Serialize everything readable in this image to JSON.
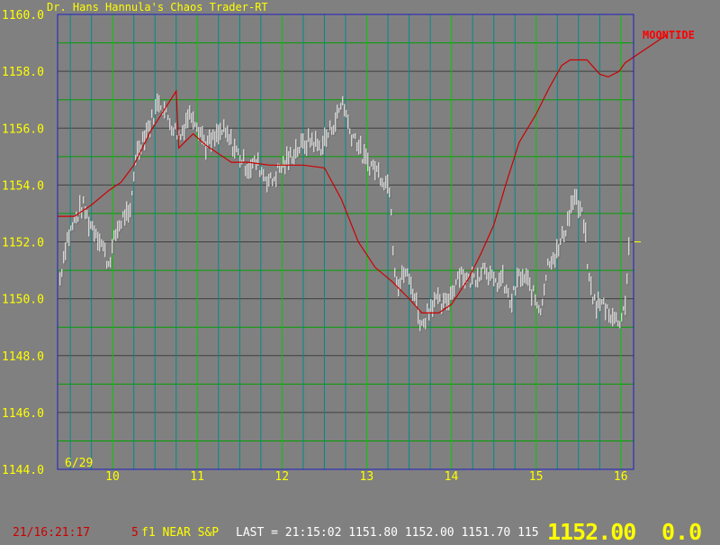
{
  "chart_data": {
    "type": "candlestick",
    "title": "Dr. Hans Hannula's Chaos Trader-RT",
    "date_label": "6/29",
    "x_ticks": [
      "10",
      "11",
      "12",
      "13",
      "14",
      "15",
      "16"
    ],
    "y_ticks": [
      "1160.0",
      "1158.0",
      "1156.0",
      "1154.0",
      "1152.0",
      "1150.0",
      "1148.0",
      "1146.0",
      "1144.0"
    ],
    "ylim": [
      1144.0,
      1160.0
    ],
    "xlim": [
      9.35,
      16.15
    ],
    "grid": true,
    "moontide_label": "MOONTIDE",
    "moontide": [
      [
        9.35,
        1152.9
      ],
      [
        9.55,
        1152.9
      ],
      [
        9.75,
        1153.3
      ],
      [
        9.95,
        1153.8
      ],
      [
        10.1,
        1154.1
      ],
      [
        10.25,
        1154.7
      ],
      [
        10.45,
        1155.9
      ],
      [
        10.6,
        1156.6
      ],
      [
        10.75,
        1157.3
      ],
      [
        10.78,
        1155.3
      ],
      [
        10.95,
        1155.8
      ],
      [
        11.1,
        1155.4
      ],
      [
        11.4,
        1154.8
      ],
      [
        11.6,
        1154.8
      ],
      [
        11.85,
        1154.7
      ],
      [
        12.25,
        1154.7
      ],
      [
        12.5,
        1154.6
      ],
      [
        12.7,
        1153.5
      ],
      [
        12.9,
        1152.0
      ],
      [
        13.1,
        1151.1
      ],
      [
        13.3,
        1150.6
      ],
      [
        13.5,
        1150.0
      ],
      [
        13.65,
        1149.5
      ],
      [
        13.85,
        1149.5
      ],
      [
        14.0,
        1149.8
      ],
      [
        14.2,
        1150.7
      ],
      [
        14.35,
        1151.6
      ],
      [
        14.5,
        1152.6
      ],
      [
        14.65,
        1154.1
      ],
      [
        14.8,
        1155.5
      ],
      [
        15.0,
        1156.5
      ],
      [
        15.15,
        1157.4
      ],
      [
        15.3,
        1158.2
      ],
      [
        15.4,
        1158.4
      ],
      [
        15.6,
        1158.4
      ],
      [
        15.75,
        1157.9
      ],
      [
        15.85,
        1157.8
      ],
      [
        15.98,
        1158.0
      ],
      [
        16.05,
        1158.3
      ],
      [
        16.3,
        1158.8
      ],
      [
        16.55,
        1159.3
      ]
    ],
    "price_anchors": [
      [
        9.38,
        1150.7
      ],
      [
        9.45,
        1152.0
      ],
      [
        9.55,
        1152.7
      ],
      [
        9.65,
        1153.3
      ],
      [
        9.72,
        1152.7
      ],
      [
        9.8,
        1152.4
      ],
      [
        9.88,
        1151.9
      ],
      [
        9.95,
        1151.2
      ],
      [
        10.05,
        1152.4
      ],
      [
        10.15,
        1153.0
      ],
      [
        10.2,
        1152.7
      ],
      [
        10.27,
        1155.0
      ],
      [
        10.35,
        1155.6
      ],
      [
        10.45,
        1156.2
      ],
      [
        10.55,
        1157.0
      ],
      [
        10.65,
        1156.4
      ],
      [
        10.72,
        1156.0
      ],
      [
        10.8,
        1155.7
      ],
      [
        10.88,
        1156.4
      ],
      [
        10.95,
        1156.5
      ],
      [
        11.05,
        1155.8
      ],
      [
        11.1,
        1155.4
      ],
      [
        11.2,
        1155.6
      ],
      [
        11.3,
        1155.9
      ],
      [
        11.4,
        1155.5
      ],
      [
        11.5,
        1155.0
      ],
      [
        11.6,
        1154.6
      ],
      [
        11.7,
        1154.8
      ],
      [
        11.8,
        1154.3
      ],
      [
        11.88,
        1154.1
      ],
      [
        11.95,
        1154.5
      ],
      [
        12.05,
        1154.8
      ],
      [
        12.15,
        1155.2
      ],
      [
        12.25,
        1155.4
      ],
      [
        12.35,
        1155.6
      ],
      [
        12.45,
        1155.3
      ],
      [
        12.55,
        1155.8
      ],
      [
        12.65,
        1156.4
      ],
      [
        12.72,
        1157.0
      ],
      [
        12.8,
        1155.9
      ],
      [
        12.88,
        1155.6
      ],
      [
        12.95,
        1155.0
      ],
      [
        13.0,
        1154.8
      ],
      [
        13.1,
        1154.6
      ],
      [
        13.2,
        1154.2
      ],
      [
        13.28,
        1153.9
      ],
      [
        13.32,
        1151.3
      ],
      [
        13.38,
        1150.4
      ],
      [
        13.45,
        1151.0
      ],
      [
        13.55,
        1150.3
      ],
      [
        13.65,
        1149.0
      ],
      [
        13.72,
        1149.6
      ],
      [
        13.8,
        1150.0
      ],
      [
        13.9,
        1149.7
      ],
      [
        14.0,
        1150.2
      ],
      [
        14.1,
        1151.0
      ],
      [
        14.2,
        1150.6
      ],
      [
        14.3,
        1150.8
      ],
      [
        14.4,
        1151.2
      ],
      [
        14.5,
        1150.5
      ],
      [
        14.6,
        1150.7
      ],
      [
        14.7,
        1149.8
      ],
      [
        14.8,
        1150.8
      ],
      [
        14.9,
        1150.6
      ],
      [
        15.0,
        1149.9
      ],
      [
        15.05,
        1149.6
      ],
      [
        15.15,
        1151.4
      ],
      [
        15.25,
        1151.6
      ],
      [
        15.35,
        1152.5
      ],
      [
        15.45,
        1153.6
      ],
      [
        15.5,
        1153.2
      ],
      [
        15.57,
        1152.7
      ],
      [
        15.62,
        1150.7
      ],
      [
        15.7,
        1149.8
      ],
      [
        15.8,
        1149.8
      ],
      [
        15.9,
        1149.4
      ],
      [
        15.95,
        1149.2
      ],
      [
        16.0,
        1149.3
      ],
      [
        16.05,
        1149.8
      ],
      [
        16.07,
        1150.6
      ],
      [
        16.1,
        1152.0
      ]
    ]
  },
  "status": {
    "time": "21/16:21:17",
    "symbol_num": "5",
    "symbol": "f1 NEAR S&P",
    "last": "LAST = 21:15:02 1151.80 1152.00 1151.70 115",
    "big_price": "1152.00",
    "change": "0.0"
  },
  "colors": {
    "background": "#808080",
    "grid_horizontal": "#404040",
    "grid_vertical_major": "#00cc00",
    "grid_vertical_minor": "#008b8b",
    "frame": "#2020c0",
    "price": "#ffffff",
    "price_shadow": "#606060",
    "moontide": "#cc0000",
    "labels": "#ffff00"
  }
}
